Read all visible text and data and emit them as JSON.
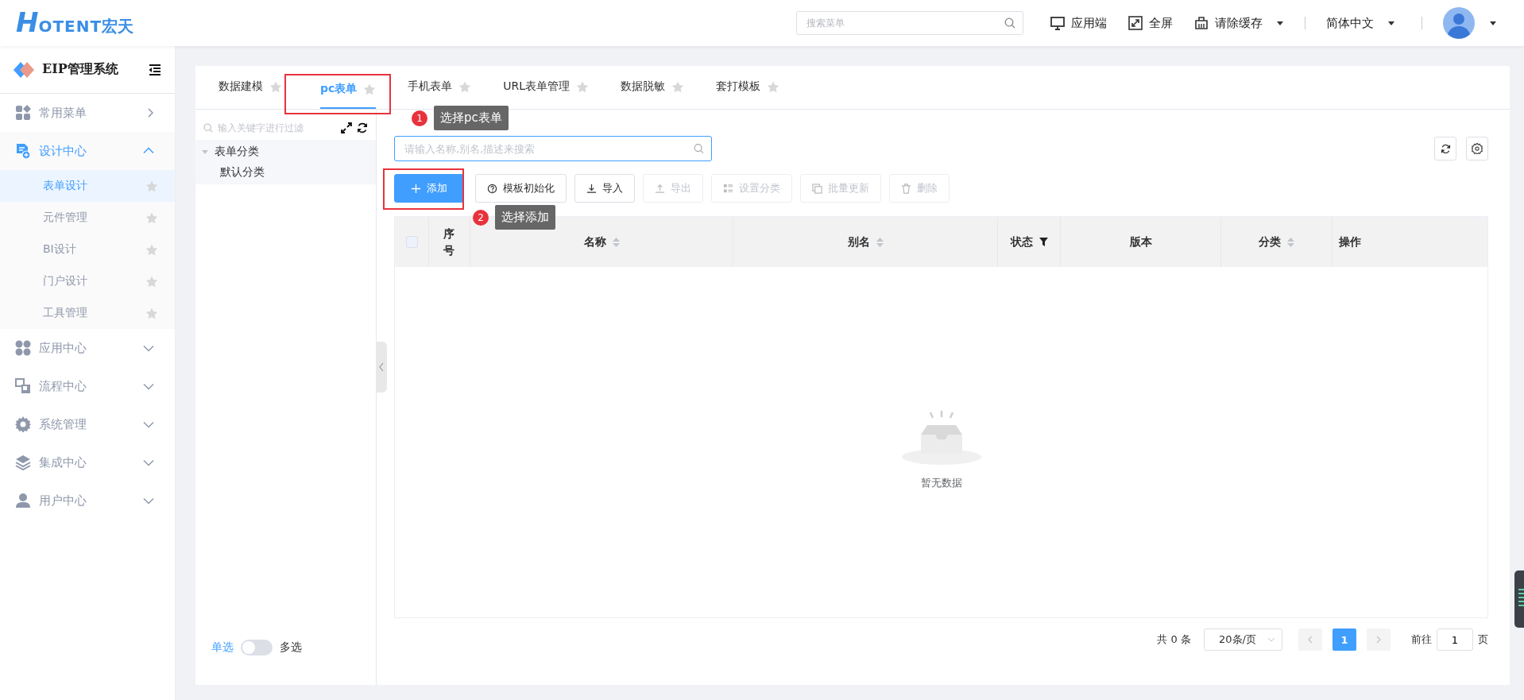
{
  "header": {
    "logo": {
      "mark": "H",
      "text": "OTENT",
      "suffix": "宏天"
    },
    "search": {
      "placeholder": "搜索菜单"
    },
    "actions": [
      {
        "kind": "monitor",
        "label": "应用端",
        "dropdown": false
      },
      {
        "kind": "fullscreen",
        "label": "全屏",
        "dropdown": false
      },
      {
        "kind": "basket",
        "label": "请除缓存",
        "dropdown": true
      }
    ],
    "language": "简体中文"
  },
  "sidebar": {
    "title": "EIP管理系统",
    "menu": [
      {
        "kind": "grid",
        "label": "常用菜单",
        "expanded": false
      },
      {
        "kind": "design",
        "label": "设计中心",
        "expanded": true,
        "children": [
          {
            "label": "表单设计",
            "selected": true
          },
          {
            "label": "元件管理",
            "selected": false
          },
          {
            "label": "BI设计",
            "selected": false
          },
          {
            "label": "门户设计",
            "selected": false
          },
          {
            "label": "工具管理",
            "selected": false
          }
        ]
      },
      {
        "kind": "apps",
        "label": "应用中心",
        "expanded": false
      },
      {
        "kind": "flow",
        "label": "流程中心",
        "expanded": false
      },
      {
        "kind": "gear",
        "label": "系统管理",
        "expanded": false
      },
      {
        "kind": "layers",
        "label": "集成中心",
        "expanded": false
      },
      {
        "kind": "user",
        "label": "用户中心",
        "expanded": false
      }
    ]
  },
  "tabs": [
    {
      "label": "数据建模",
      "selected": false
    },
    {
      "label": "pc表单",
      "selected": true
    },
    {
      "label": "手机表单",
      "selected": false
    },
    {
      "label": "URL表单管理",
      "selected": false
    },
    {
      "label": "数据脱敏",
      "selected": false
    },
    {
      "label": "套打模板",
      "selected": false
    }
  ],
  "tree": {
    "placeholder": "输入关键字进行过滤",
    "nodes": [
      {
        "label": "表单分类",
        "expanded": true,
        "children": [
          {
            "label": "默认分类"
          }
        ]
      }
    ],
    "selection": {
      "single": "单选",
      "multiple": "多选",
      "on": false
    }
  },
  "list": {
    "search": {
      "placeholder": "请输入名称,别名,描述来搜索"
    },
    "toolbar": [
      {
        "kind": "plus",
        "label": "添加",
        "primary": true,
        "disabled": false
      },
      {
        "kind": "help",
        "label": "模板初始化",
        "primary": false,
        "disabled": false
      },
      {
        "kind": "download",
        "label": "导入",
        "primary": false,
        "disabled": false
      },
      {
        "kind": "upload",
        "label": "导出",
        "primary": false,
        "disabled": true
      },
      {
        "kind": "category",
        "label": "设置分类",
        "primary": false,
        "disabled": true
      },
      {
        "kind": "copy",
        "label": "批量更新",
        "primary": false,
        "disabled": true
      },
      {
        "kind": "trash",
        "label": "删除",
        "primary": false,
        "disabled": true
      }
    ],
    "table": {
      "select_all": {
        "checked": false
      },
      "columns": [
        {
          "label": "序号",
          "kind": "plain"
        },
        {
          "label": "名称",
          "kind": "sort"
        },
        {
          "label": "别名",
          "kind": "sort"
        },
        {
          "label": "状态",
          "kind": "filter"
        },
        {
          "label": "版本",
          "kind": "plain"
        },
        {
          "label": "分类",
          "kind": "sort"
        },
        {
          "label": "操作",
          "kind": "plain"
        }
      ],
      "empty_text": "暂无数据"
    },
    "pagination": {
      "total": "共 0 条",
      "page_size": "20条/页",
      "pages": [
        {
          "label": "1",
          "selected": true
        }
      ],
      "goto_label": "前往",
      "goto_value": "1",
      "goto_suffix": "页"
    }
  },
  "annotations": [
    {
      "number": "1",
      "text": "选择pc表单"
    },
    {
      "number": "2",
      "text": "选择添加"
    }
  ]
}
